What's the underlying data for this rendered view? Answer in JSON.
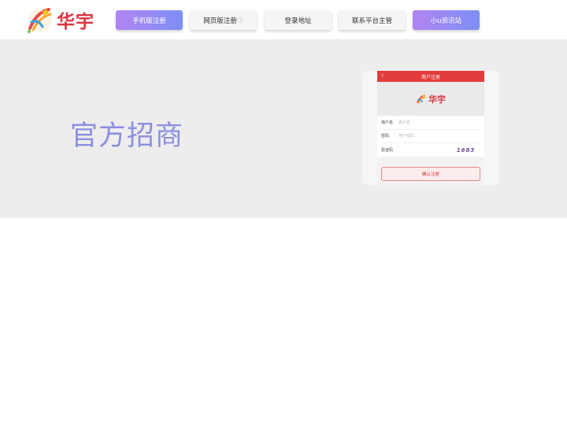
{
  "header": {
    "logo_text": "华宇",
    "nav": [
      {
        "label": "手机版注册",
        "style": "gradient"
      },
      {
        "label": "网页版注册",
        "style": "plain",
        "info": "ⓘ"
      },
      {
        "label": "登录地址",
        "style": "plain"
      },
      {
        "label": "联系平台主管",
        "style": "plain"
      },
      {
        "label": "小u资讯站",
        "style": "gradient"
      }
    ]
  },
  "hero": {
    "title": "官方招商",
    "phone": {
      "header_title": "用户注册",
      "back_icon": "‹",
      "logo_text": "华宇",
      "fields": [
        {
          "label": "用户名",
          "placeholder": "用户名"
        },
        {
          "label": "密码",
          "placeholder": "用户密码"
        },
        {
          "label": "验证码",
          "placeholder": ""
        }
      ],
      "captcha": "1683",
      "submit_label": "确认注册"
    }
  },
  "colors": {
    "accent_gradient_start": "#b184f2",
    "accent_gradient_end": "#7d8ff5",
    "hero_title": "#8c8ee0",
    "phone_header": "#e23b3b",
    "logo_red": "#d9363e"
  },
  "icons": {
    "logo": "rocket-star-logo-icon",
    "back": "chevron-left-icon",
    "info": "info-circle-icon"
  }
}
